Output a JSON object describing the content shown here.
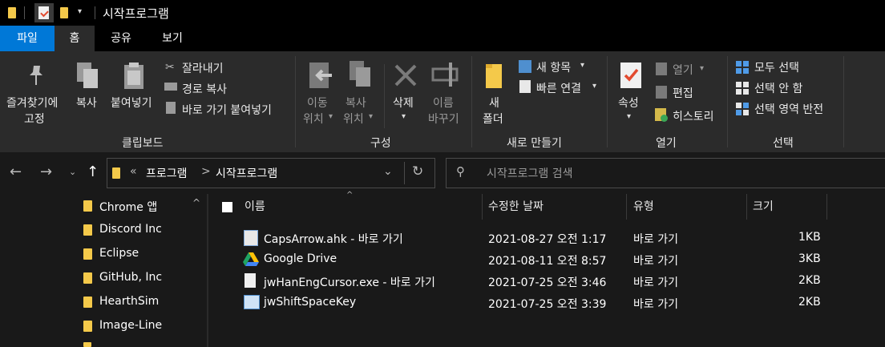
{
  "window": {
    "title": "시작프로그램"
  },
  "tabs": [
    {
      "label": "파일"
    },
    {
      "label": "홈"
    },
    {
      "label": "공유"
    },
    {
      "label": "보기"
    }
  ],
  "ribbon": {
    "clipboard": {
      "pin_label_1": "즐겨찾기에",
      "pin_label_2": "고정",
      "copy": "복사",
      "paste": "붙여넣기",
      "cut": "잘라내기",
      "copy_path": "경로 복사",
      "paste_shortcut": "바로 가기 붙여넣기",
      "group": "클립보드"
    },
    "organize": {
      "move_1": "이동",
      "move_2": "위치",
      "copyto_1": "복사",
      "copyto_2": "위치",
      "delete": "삭제",
      "rename_1": "이름",
      "rename_2": "바꾸기",
      "group": "구성"
    },
    "new": {
      "folder_1": "새",
      "folder_2": "폴더",
      "new_item": "새 항목",
      "easy_access": "빠른 연결",
      "group": "새로 만들기"
    },
    "open": {
      "properties": "속성",
      "open": "열기",
      "edit": "편집",
      "history": "히스토리",
      "group": "열기"
    },
    "select": {
      "select_all": "모두 선택",
      "select_none": "선택 안 함",
      "invert": "선택 영역 반전",
      "group": "선택"
    }
  },
  "address": {
    "breadcrumb_prefix": "«",
    "crumb1": "프로그램",
    "sep": ">",
    "crumb2": "시작프로그램",
    "search_placeholder": "시작프로그램 검색"
  },
  "nav": {
    "items": [
      {
        "label": "Chrome 앱"
      },
      {
        "label": "Discord Inc"
      },
      {
        "label": "Eclipse"
      },
      {
        "label": "GitHub, Inc"
      },
      {
        "label": "HearthSim"
      },
      {
        "label": "Image-Line"
      }
    ]
  },
  "columns": {
    "name": "이름",
    "modified": "수정한 날짜",
    "type": "유형",
    "size": "크기"
  },
  "files": [
    {
      "name": "CapsArrow.ahk - 바로 가기",
      "modified": "2021-08-27 오전 1:17",
      "type": "바로 가기",
      "size": "1KB",
      "icon": "shortcut-icon"
    },
    {
      "name": "Google Drive",
      "modified": "2021-08-11 오전 8:57",
      "type": "바로 가기",
      "size": "3KB",
      "icon": "google-drive-icon"
    },
    {
      "name": "jwHanEngCursor.exe - 바로 가기",
      "modified": "2021-07-25 오전 3:46",
      "type": "바로 가기",
      "size": "2KB",
      "icon": "exe-shortcut-icon"
    },
    {
      "name": "jwShiftSpaceKey",
      "modified": "2021-07-25 오전 3:39",
      "type": "바로 가기",
      "size": "2KB",
      "icon": "app-shortcut-icon"
    }
  ],
  "colors": {
    "accent": "#0078d7",
    "folder": "#f4c94a",
    "ribbon_bg": "#2b2b2b",
    "window_bg": "#191919"
  }
}
